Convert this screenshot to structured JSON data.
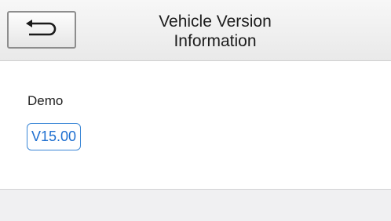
{
  "header": {
    "title_line1": "Vehicle Version",
    "title_line2": "Information",
    "back_icon": "back-arrow-icon"
  },
  "content": {
    "vehicle_name": "Demo",
    "version": "V15.00"
  },
  "colors": {
    "accent": "#1e6fd0",
    "header_bg": "#ececec",
    "footer_bg": "#f0f0f2"
  }
}
